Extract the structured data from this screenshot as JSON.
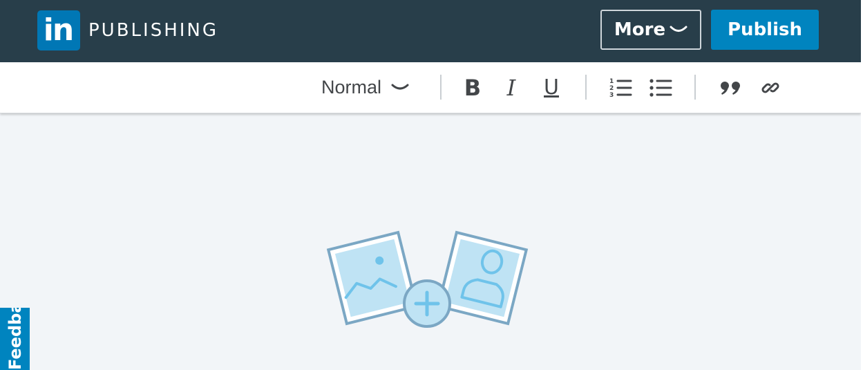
{
  "header": {
    "logo_text": "in",
    "brand_label": "PUBLISHING",
    "more_label": "More",
    "publish_label": "Publish"
  },
  "toolbar": {
    "style_value": "Normal",
    "bold_label": "B",
    "italic_label": "I",
    "underline_label": "U"
  },
  "feedback": {
    "label": "Feedback"
  },
  "icons": {
    "logo": "linkedin-logo",
    "style_dropdown": "chevron-down-icon",
    "ordered_list": "ordered-list-icon",
    "bulleted_list": "bulleted-list-icon",
    "quote": "quote-icon",
    "link": "link-icon",
    "cover_image": "add-image-illustration"
  },
  "colors": {
    "header_bg": "#283e4a",
    "brand_blue": "#0077b5",
    "publish_bg": "#0084bf",
    "canvas_bg": "#f2f5f8",
    "illustration_stroke": "#7ba7c4",
    "illustration_fill": "#bfe3f4"
  }
}
